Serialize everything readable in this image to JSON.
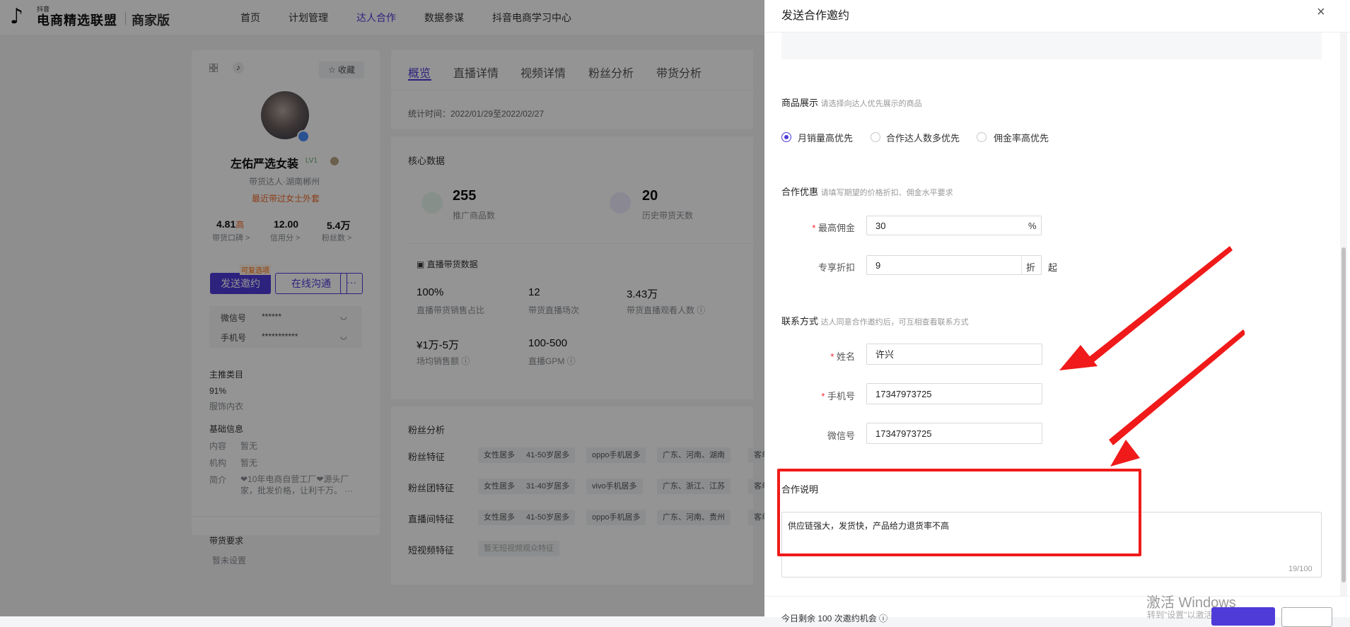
{
  "app": {
    "logo_small": "抖音",
    "logo_title": "电商精选联盟",
    "logo_sub": "商家版"
  },
  "nav": {
    "items": [
      "首页",
      "计划管理",
      "达人合作",
      "数据参谋",
      "抖音电商学习中心"
    ],
    "active": "达人合作"
  },
  "profile": {
    "fav": "☆ 收藏",
    "name": "左佑严选女装",
    "level": "LV1",
    "desc": "带货达人·湖南郴州",
    "recent": "最近带过女士外套",
    "stats": [
      {
        "value": "4.81",
        "extra": "高",
        "label": "带货口碑 >"
      },
      {
        "value": "12.00",
        "extra": "",
        "label": "信用分 >"
      },
      {
        "value": "5.4万",
        "extra": "",
        "label": "粉丝数 >"
      }
    ],
    "send_button": "发送邀约",
    "send_tag": "可复选项",
    "chat_button": "在线沟通",
    "more_button": "···",
    "wechat_label": "微信号",
    "wechat_value": "******",
    "phone_label": "手机号",
    "phone_value": "***********",
    "main_cat_title": "主推类目",
    "main_cat_pct": "91%",
    "main_cat_name": "服饰内衣",
    "basic_title": "基础信息",
    "basic_rows": [
      {
        "k": "内容",
        "v": "暂无"
      },
      {
        "k": "机构",
        "v": "暂无"
      },
      {
        "k": "简介",
        "v": "❤10年电商自营工厂❤源头厂家，批发价格，让利千万。 ···"
      }
    ],
    "req_title": "带货要求",
    "req_value": "暂未设置"
  },
  "tabs": {
    "items": [
      "概览",
      "直播详情",
      "视频详情",
      "粉丝分析",
      "带货分析"
    ],
    "period": "统计时间：2022/01/29至2022/02/27"
  },
  "core": {
    "title": "核心数据",
    "kpis": [
      {
        "value": "255",
        "label": "推广商品数"
      },
      {
        "value": "20",
        "label": "历史带货天数"
      }
    ],
    "live_title": "▣ 直播带货数据",
    "live": [
      {
        "value": "100%",
        "label": "直播带货销售占比"
      },
      {
        "value": "12",
        "label": "带货直播场次"
      },
      {
        "value": "3.43万",
        "label": "带货直播观看人数 ⓘ"
      },
      {
        "value": "¥1万-5万",
        "label": "场均销售额 ⓘ"
      },
      {
        "value": "100-500",
        "label": "直播GPM ⓘ"
      }
    ]
  },
  "fans": {
    "title": "粉丝分析",
    "rows": [
      {
        "label": "粉丝特征",
        "chips": [
          "女性居多",
          "41-50岁居多",
          "oppo手机居多",
          "广东、河南、湖南",
          "客单"
        ]
      },
      {
        "label": "粉丝团特征",
        "chips": [
          "女性居多",
          "31-40岁居多",
          "vivo手机居多",
          "广东、浙江、江苏",
          "客单"
        ]
      },
      {
        "label": "直播间特征",
        "chips": [
          "女性居多",
          "41-50岁居多",
          "oppo手机居多",
          "广东、河南、贵州",
          "客单"
        ]
      },
      {
        "label": "短视频特征",
        "chips": [
          "暂无短视频观众特征"
        ]
      }
    ]
  },
  "drawer": {
    "title": "发送合作邀约",
    "close": "×",
    "product_label": "商品展示",
    "product_hint": "请选择向达人优先展示的商品",
    "radios": [
      "月销量高优先",
      "合作达人数多优先",
      "佣金率高优先"
    ],
    "radio_selected": 0,
    "offer_label": "合作优惠",
    "offer_hint": "请填写期望的价格折扣、佣金水平要求",
    "commission_label": "最高佣金",
    "commission_value": "30",
    "commission_suffix": "%",
    "discount_label": "专享折扣",
    "discount_value": "9",
    "discount_suffix": "折",
    "discount_after": "起",
    "contact_label": "联系方式",
    "contact_hint": "达人同意合作邀约后，可互相查看联系方式",
    "name_label": "姓名",
    "name_value": "许兴",
    "phone_label": "手机号",
    "phone_value": "17347973725",
    "wechat_label": "微信号",
    "wechat_value": "17347973725",
    "note_label": "合作说明",
    "note_value": "供应链强大，发货快，产品给力退货率不高",
    "note_counter": "19/100",
    "footer_text": "今日剩余 100 次邀约机会 ⓘ",
    "watermark_1": "激活 Windows",
    "watermark_2": "转到\"设置\"以激活"
  },
  "colors": {
    "brand": "#4e3bd8",
    "annotation_red": "#f01a1a",
    "overlay": "rgba(0,0,0,0.42)"
  }
}
